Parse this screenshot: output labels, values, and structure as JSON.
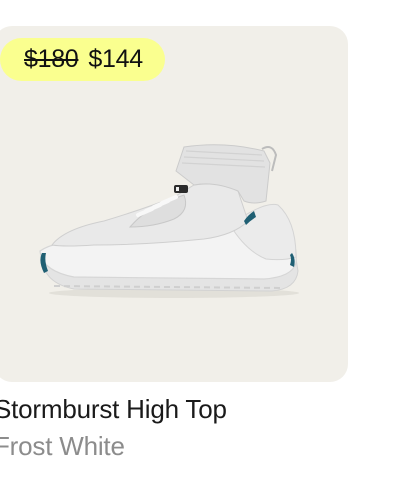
{
  "product": {
    "price_original": "$180",
    "price_sale": "$144",
    "name": "Stormburst High Top",
    "color": "Frost White"
  },
  "image": {
    "icon": "sneaker-image",
    "background_color": "#f1efe9",
    "badge_color": "#faff8f",
    "accent_color": "#1f5f73"
  }
}
